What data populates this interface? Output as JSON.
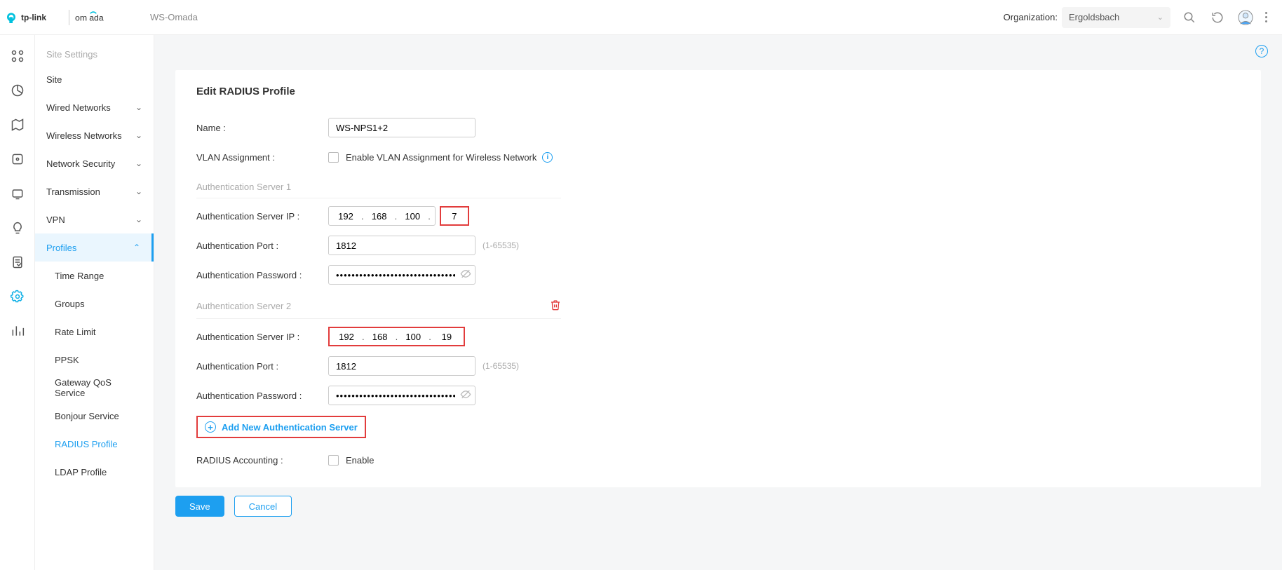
{
  "header": {
    "breadcrumb": "WS-Omada",
    "org_label": "Organization:",
    "org_value": "Ergoldsbach"
  },
  "iconrail": [
    {
      "name": "grid-icon"
    },
    {
      "name": "pie-icon"
    },
    {
      "name": "map-icon"
    },
    {
      "name": "devices-icon"
    },
    {
      "name": "clients-icon"
    },
    {
      "name": "bulb-icon"
    },
    {
      "name": "log-icon"
    },
    {
      "name": "wrench-icon"
    },
    {
      "name": "report-icon"
    }
  ],
  "sidebar": {
    "section_title": "Site Settings",
    "items": [
      {
        "label": "Site",
        "expandable": false
      },
      {
        "label": "Wired Networks",
        "expandable": true
      },
      {
        "label": "Wireless Networks",
        "expandable": true
      },
      {
        "label": "Network Security",
        "expandable": true
      },
      {
        "label": "Transmission",
        "expandable": true
      },
      {
        "label": "VPN",
        "expandable": true
      },
      {
        "label": "Profiles",
        "expandable": true,
        "active": true,
        "open": true
      }
    ],
    "profiles_children": [
      {
        "label": "Time Range"
      },
      {
        "label": "Groups"
      },
      {
        "label": "Rate Limit"
      },
      {
        "label": "PPSK"
      },
      {
        "label": "Gateway QoS Service"
      },
      {
        "label": "Bonjour Service"
      },
      {
        "label": "RADIUS Profile",
        "active": true
      },
      {
        "label": "LDAP Profile"
      }
    ]
  },
  "form": {
    "title": "Edit RADIUS Profile",
    "name_label": "Name",
    "name_value": "WS-NPS1+2",
    "vlan_label": "VLAN Assignment",
    "vlan_check_label": "Enable VLAN Assignment for Wireless Network",
    "server1_header": "Authentication Server 1",
    "server2_header": "Authentication Server 2",
    "ip_label": "Authentication Server IP",
    "port_label": "Authentication Port",
    "port_hint": "(1-65535)",
    "pw_label": "Authentication Password",
    "server1_ip": {
      "a": "192",
      "b": "168",
      "c": "100",
      "d": "7"
    },
    "server1_port": "1812",
    "server1_pw": "••••••••••••••••••••••••••••••••",
    "server2_ip": {
      "a": "192",
      "b": "168",
      "c": "100",
      "d": "19"
    },
    "server2_port": "1812",
    "server2_pw": "••••••••••••••••••••••••••••••••",
    "add_server_label": "Add New Authentication Server",
    "accounting_label": "RADIUS Accounting",
    "accounting_check_label": "Enable",
    "save_label": "Save",
    "cancel_label": "Cancel"
  }
}
